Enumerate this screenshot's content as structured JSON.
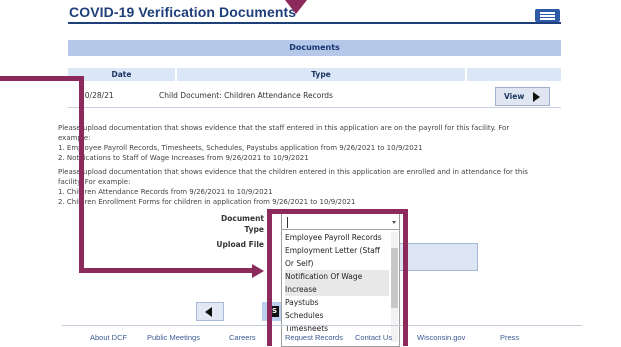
{
  "page": {
    "title": "COVID-19 Verification Documents"
  },
  "documents": {
    "header": "Documents",
    "columns": [
      "Date",
      "Type"
    ],
    "rows": [
      {
        "date": "10/28/21",
        "type": "Child Document: Children Attendance Records",
        "action": "View"
      }
    ]
  },
  "instructions": {
    "staff_lines": [
      "Please upload documentation that shows evidence that the staff entered in this application are on the payroll for this facility. For",
      "example:",
      "1. Employee Payroll Records, Timesheets, Schedules, Paystubs application from 9/26/2021 to 10/9/2021",
      "2. Notifications to Staff of Wage Increases from 9/26/2021 to 10/9/2021"
    ],
    "children_lines": [
      "Please upload documentation that shows evidence that the children entered in this application are enrolled and in attendance for this",
      "facility. For example:",
      "1. Children Attendance Records from 9/26/2021 to 10/9/2021",
      "2. Children Enrollment Forms for children in application from 9/26/2021 to 10/9/2021"
    ]
  },
  "form": {
    "document_label_line1": "Document",
    "document_label_line2": "Type",
    "upload_label": "Upload File",
    "select_value": "",
    "options": [
      {
        "label": "Employee Payroll Records",
        "highlighted": false
      },
      {
        "label": "Employment Letter (Staff",
        "highlighted": false
      },
      {
        "label": "Or Self)",
        "highlighted": false
      },
      {
        "label": "Notification Of Wage",
        "highlighted": true
      },
      {
        "label": "Increase",
        "highlighted": true
      },
      {
        "label": "Paystubs",
        "highlighted": false
      },
      {
        "label": "Schedules",
        "highlighted": false
      },
      {
        "label": "Timesheets",
        "highlighted": false
      }
    ]
  },
  "footer": {
    "links": [
      "About DCF",
      "Public Meetings",
      "Careers",
      "Request Records",
      "Contact Us",
      "Wisconsin.gov",
      "Press"
    ]
  },
  "colors": {
    "annotation": "#8c2a5c",
    "title": "#1f3f7a",
    "header_fill": "#b5c8ea"
  },
  "icons": {
    "menu": "hamburger-icon",
    "view": "play-triangle-icon",
    "back": "left-triangle-icon"
  }
}
